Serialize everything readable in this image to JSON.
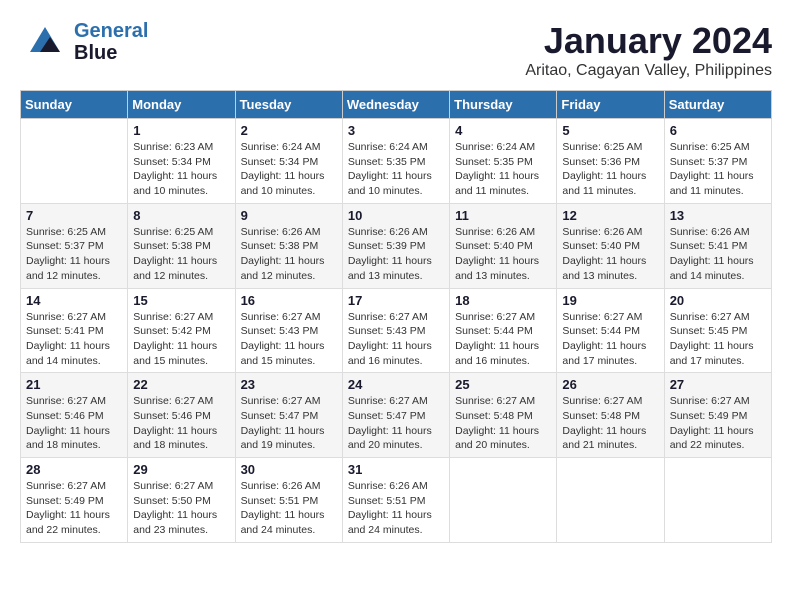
{
  "header": {
    "logo": {
      "line1": "General",
      "line2": "Blue"
    },
    "title": "January 2024",
    "location": "Aritao, Cagayan Valley, Philippines"
  },
  "calendar": {
    "days": [
      "Sunday",
      "Monday",
      "Tuesday",
      "Wednesday",
      "Thursday",
      "Friday",
      "Saturday"
    ],
    "weeks": [
      [
        {
          "day": "",
          "info": ""
        },
        {
          "day": "1",
          "info": "Sunrise: 6:23 AM\nSunset: 5:34 PM\nDaylight: 11 hours\nand 10 minutes."
        },
        {
          "day": "2",
          "info": "Sunrise: 6:24 AM\nSunset: 5:34 PM\nDaylight: 11 hours\nand 10 minutes."
        },
        {
          "day": "3",
          "info": "Sunrise: 6:24 AM\nSunset: 5:35 PM\nDaylight: 11 hours\nand 10 minutes."
        },
        {
          "day": "4",
          "info": "Sunrise: 6:24 AM\nSunset: 5:35 PM\nDaylight: 11 hours\nand 11 minutes."
        },
        {
          "day": "5",
          "info": "Sunrise: 6:25 AM\nSunset: 5:36 PM\nDaylight: 11 hours\nand 11 minutes."
        },
        {
          "day": "6",
          "info": "Sunrise: 6:25 AM\nSunset: 5:37 PM\nDaylight: 11 hours\nand 11 minutes."
        }
      ],
      [
        {
          "day": "7",
          "info": "Sunrise: 6:25 AM\nSunset: 5:37 PM\nDaylight: 11 hours\nand 12 minutes."
        },
        {
          "day": "8",
          "info": "Sunrise: 6:25 AM\nSunset: 5:38 PM\nDaylight: 11 hours\nand 12 minutes."
        },
        {
          "day": "9",
          "info": "Sunrise: 6:26 AM\nSunset: 5:38 PM\nDaylight: 11 hours\nand 12 minutes."
        },
        {
          "day": "10",
          "info": "Sunrise: 6:26 AM\nSunset: 5:39 PM\nDaylight: 11 hours\nand 13 minutes."
        },
        {
          "day": "11",
          "info": "Sunrise: 6:26 AM\nSunset: 5:40 PM\nDaylight: 11 hours\nand 13 minutes."
        },
        {
          "day": "12",
          "info": "Sunrise: 6:26 AM\nSunset: 5:40 PM\nDaylight: 11 hours\nand 13 minutes."
        },
        {
          "day": "13",
          "info": "Sunrise: 6:26 AM\nSunset: 5:41 PM\nDaylight: 11 hours\nand 14 minutes."
        }
      ],
      [
        {
          "day": "14",
          "info": "Sunrise: 6:27 AM\nSunset: 5:41 PM\nDaylight: 11 hours\nand 14 minutes."
        },
        {
          "day": "15",
          "info": "Sunrise: 6:27 AM\nSunset: 5:42 PM\nDaylight: 11 hours\nand 15 minutes."
        },
        {
          "day": "16",
          "info": "Sunrise: 6:27 AM\nSunset: 5:43 PM\nDaylight: 11 hours\nand 15 minutes."
        },
        {
          "day": "17",
          "info": "Sunrise: 6:27 AM\nSunset: 5:43 PM\nDaylight: 11 hours\nand 16 minutes."
        },
        {
          "day": "18",
          "info": "Sunrise: 6:27 AM\nSunset: 5:44 PM\nDaylight: 11 hours\nand 16 minutes."
        },
        {
          "day": "19",
          "info": "Sunrise: 6:27 AM\nSunset: 5:44 PM\nDaylight: 11 hours\nand 17 minutes."
        },
        {
          "day": "20",
          "info": "Sunrise: 6:27 AM\nSunset: 5:45 PM\nDaylight: 11 hours\nand 17 minutes."
        }
      ],
      [
        {
          "day": "21",
          "info": "Sunrise: 6:27 AM\nSunset: 5:46 PM\nDaylight: 11 hours\nand 18 minutes."
        },
        {
          "day": "22",
          "info": "Sunrise: 6:27 AM\nSunset: 5:46 PM\nDaylight: 11 hours\nand 18 minutes."
        },
        {
          "day": "23",
          "info": "Sunrise: 6:27 AM\nSunset: 5:47 PM\nDaylight: 11 hours\nand 19 minutes."
        },
        {
          "day": "24",
          "info": "Sunrise: 6:27 AM\nSunset: 5:47 PM\nDaylight: 11 hours\nand 20 minutes."
        },
        {
          "day": "25",
          "info": "Sunrise: 6:27 AM\nSunset: 5:48 PM\nDaylight: 11 hours\nand 20 minutes."
        },
        {
          "day": "26",
          "info": "Sunrise: 6:27 AM\nSunset: 5:48 PM\nDaylight: 11 hours\nand 21 minutes."
        },
        {
          "day": "27",
          "info": "Sunrise: 6:27 AM\nSunset: 5:49 PM\nDaylight: 11 hours\nand 22 minutes."
        }
      ],
      [
        {
          "day": "28",
          "info": "Sunrise: 6:27 AM\nSunset: 5:49 PM\nDaylight: 11 hours\nand 22 minutes."
        },
        {
          "day": "29",
          "info": "Sunrise: 6:27 AM\nSunset: 5:50 PM\nDaylight: 11 hours\nand 23 minutes."
        },
        {
          "day": "30",
          "info": "Sunrise: 6:26 AM\nSunset: 5:51 PM\nDaylight: 11 hours\nand 24 minutes."
        },
        {
          "day": "31",
          "info": "Sunrise: 6:26 AM\nSunset: 5:51 PM\nDaylight: 11 hours\nand 24 minutes."
        },
        {
          "day": "",
          "info": ""
        },
        {
          "day": "",
          "info": ""
        },
        {
          "day": "",
          "info": ""
        }
      ]
    ]
  }
}
